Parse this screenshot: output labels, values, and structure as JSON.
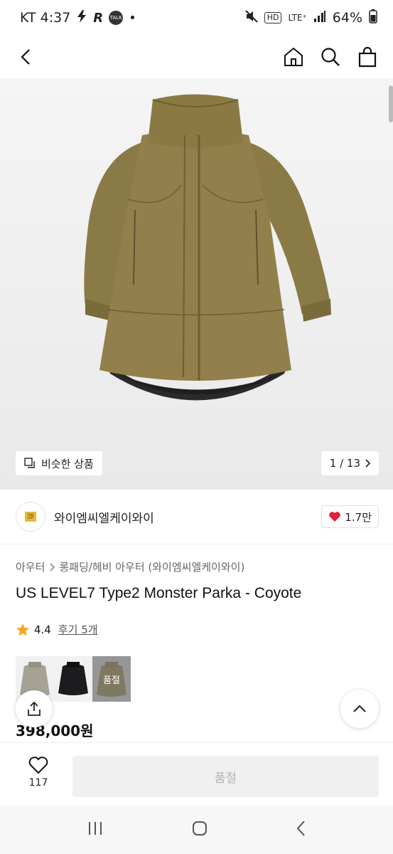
{
  "status": {
    "carrier_time": "KT 4:37",
    "dot": "•",
    "talk": "TALK",
    "hd": "HD",
    "lte": "LTE⁺",
    "battery": "64%"
  },
  "gallery": {
    "similar_label": "비슷한 상품",
    "counter": "1 / 13"
  },
  "brand": {
    "logo_text": "THIS LIST",
    "name": "와이엠씨엘케이와이",
    "likes": "1.7만"
  },
  "product": {
    "breadcrumb": [
      "아우터",
      "롱패딩/헤비 아우터 (와이엠씨엘케이와이)"
    ],
    "title": "US LEVEL7 Type2 Monster Parka - Coyote",
    "rating": "4.4",
    "review_label": "후기 5개",
    "soldout_tag": "품절",
    "price": "398,000원"
  },
  "bottom_bar": {
    "wish_count": "117",
    "soldout_button": "품절"
  },
  "colors": {
    "coyote": "#8b7a45",
    "heart": "#e0243a",
    "star": "#f4a623"
  }
}
